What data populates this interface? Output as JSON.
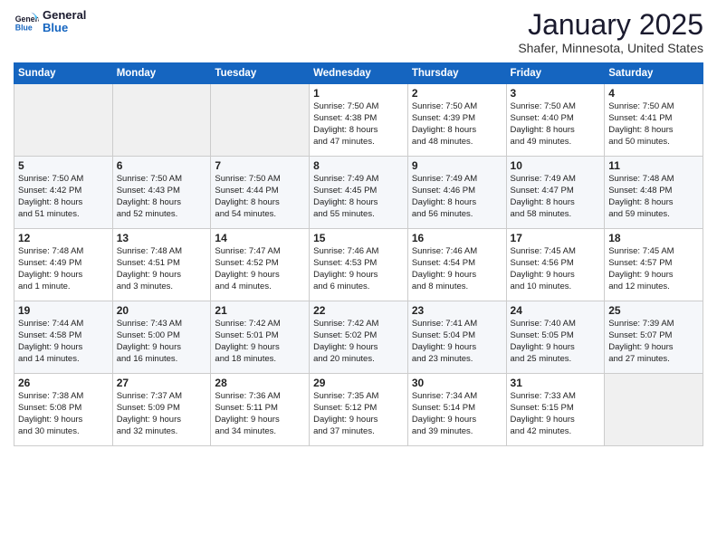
{
  "logo": {
    "line1": "General",
    "line2": "Blue"
  },
  "title": "January 2025",
  "location": "Shafer, Minnesota, United States",
  "weekdays": [
    "Sunday",
    "Monday",
    "Tuesday",
    "Wednesday",
    "Thursday",
    "Friday",
    "Saturday"
  ],
  "weeks": [
    [
      {
        "day": "",
        "info": ""
      },
      {
        "day": "",
        "info": ""
      },
      {
        "day": "",
        "info": ""
      },
      {
        "day": "1",
        "info": "Sunrise: 7:50 AM\nSunset: 4:38 PM\nDaylight: 8 hours\nand 47 minutes."
      },
      {
        "day": "2",
        "info": "Sunrise: 7:50 AM\nSunset: 4:39 PM\nDaylight: 8 hours\nand 48 minutes."
      },
      {
        "day": "3",
        "info": "Sunrise: 7:50 AM\nSunset: 4:40 PM\nDaylight: 8 hours\nand 49 minutes."
      },
      {
        "day": "4",
        "info": "Sunrise: 7:50 AM\nSunset: 4:41 PM\nDaylight: 8 hours\nand 50 minutes."
      }
    ],
    [
      {
        "day": "5",
        "info": "Sunrise: 7:50 AM\nSunset: 4:42 PM\nDaylight: 8 hours\nand 51 minutes."
      },
      {
        "day": "6",
        "info": "Sunrise: 7:50 AM\nSunset: 4:43 PM\nDaylight: 8 hours\nand 52 minutes."
      },
      {
        "day": "7",
        "info": "Sunrise: 7:50 AM\nSunset: 4:44 PM\nDaylight: 8 hours\nand 54 minutes."
      },
      {
        "day": "8",
        "info": "Sunrise: 7:49 AM\nSunset: 4:45 PM\nDaylight: 8 hours\nand 55 minutes."
      },
      {
        "day": "9",
        "info": "Sunrise: 7:49 AM\nSunset: 4:46 PM\nDaylight: 8 hours\nand 56 minutes."
      },
      {
        "day": "10",
        "info": "Sunrise: 7:49 AM\nSunset: 4:47 PM\nDaylight: 8 hours\nand 58 minutes."
      },
      {
        "day": "11",
        "info": "Sunrise: 7:48 AM\nSunset: 4:48 PM\nDaylight: 8 hours\nand 59 minutes."
      }
    ],
    [
      {
        "day": "12",
        "info": "Sunrise: 7:48 AM\nSunset: 4:49 PM\nDaylight: 9 hours\nand 1 minute."
      },
      {
        "day": "13",
        "info": "Sunrise: 7:48 AM\nSunset: 4:51 PM\nDaylight: 9 hours\nand 3 minutes."
      },
      {
        "day": "14",
        "info": "Sunrise: 7:47 AM\nSunset: 4:52 PM\nDaylight: 9 hours\nand 4 minutes."
      },
      {
        "day": "15",
        "info": "Sunrise: 7:46 AM\nSunset: 4:53 PM\nDaylight: 9 hours\nand 6 minutes."
      },
      {
        "day": "16",
        "info": "Sunrise: 7:46 AM\nSunset: 4:54 PM\nDaylight: 9 hours\nand 8 minutes."
      },
      {
        "day": "17",
        "info": "Sunrise: 7:45 AM\nSunset: 4:56 PM\nDaylight: 9 hours\nand 10 minutes."
      },
      {
        "day": "18",
        "info": "Sunrise: 7:45 AM\nSunset: 4:57 PM\nDaylight: 9 hours\nand 12 minutes."
      }
    ],
    [
      {
        "day": "19",
        "info": "Sunrise: 7:44 AM\nSunset: 4:58 PM\nDaylight: 9 hours\nand 14 minutes."
      },
      {
        "day": "20",
        "info": "Sunrise: 7:43 AM\nSunset: 5:00 PM\nDaylight: 9 hours\nand 16 minutes."
      },
      {
        "day": "21",
        "info": "Sunrise: 7:42 AM\nSunset: 5:01 PM\nDaylight: 9 hours\nand 18 minutes."
      },
      {
        "day": "22",
        "info": "Sunrise: 7:42 AM\nSunset: 5:02 PM\nDaylight: 9 hours\nand 20 minutes."
      },
      {
        "day": "23",
        "info": "Sunrise: 7:41 AM\nSunset: 5:04 PM\nDaylight: 9 hours\nand 23 minutes."
      },
      {
        "day": "24",
        "info": "Sunrise: 7:40 AM\nSunset: 5:05 PM\nDaylight: 9 hours\nand 25 minutes."
      },
      {
        "day": "25",
        "info": "Sunrise: 7:39 AM\nSunset: 5:07 PM\nDaylight: 9 hours\nand 27 minutes."
      }
    ],
    [
      {
        "day": "26",
        "info": "Sunrise: 7:38 AM\nSunset: 5:08 PM\nDaylight: 9 hours\nand 30 minutes."
      },
      {
        "day": "27",
        "info": "Sunrise: 7:37 AM\nSunset: 5:09 PM\nDaylight: 9 hours\nand 32 minutes."
      },
      {
        "day": "28",
        "info": "Sunrise: 7:36 AM\nSunset: 5:11 PM\nDaylight: 9 hours\nand 34 minutes."
      },
      {
        "day": "29",
        "info": "Sunrise: 7:35 AM\nSunset: 5:12 PM\nDaylight: 9 hours\nand 37 minutes."
      },
      {
        "day": "30",
        "info": "Sunrise: 7:34 AM\nSunset: 5:14 PM\nDaylight: 9 hours\nand 39 minutes."
      },
      {
        "day": "31",
        "info": "Sunrise: 7:33 AM\nSunset: 5:15 PM\nDaylight: 9 hours\nand 42 minutes."
      },
      {
        "day": "",
        "info": ""
      }
    ]
  ]
}
